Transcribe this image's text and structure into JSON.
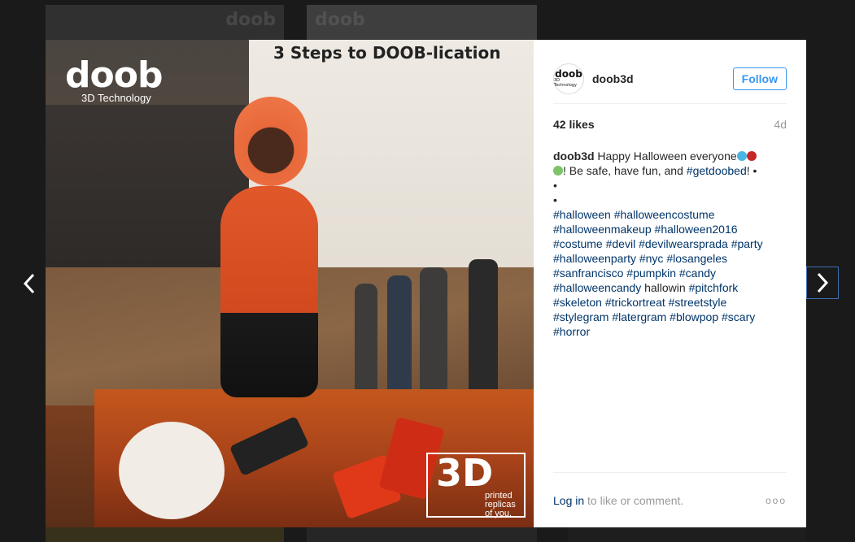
{
  "background": {
    "tiles": [
      "doob",
      "doob",
      "doob"
    ]
  },
  "post": {
    "image": {
      "brand": "doob",
      "brand_sub": "3D Technology",
      "sign": "3 Steps to DOOB-lication",
      "stamp_big": "3D",
      "stamp_small": "printed replicas of you."
    },
    "author": {
      "avatar_text": "doob",
      "avatar_sub": "3D Technology",
      "username": "doob3d",
      "follow_label": "Follow"
    },
    "likes": "42 likes",
    "age": "4d",
    "caption": {
      "user": "doob3d",
      "text_1": " Happy Halloween everyone",
      "text_2": "! Be safe, have fun, and ",
      "tag_getdoobed": "#getdoobed",
      "text_3": "! •",
      "bullet_1": "•",
      "bullet_2": "•",
      "hashtags": [
        "#halloween",
        "#halloweencostume",
        "#halloweenmakeup",
        "#halloween2016",
        "#costume",
        "#devil",
        "#devilwearsprada",
        "#party",
        "#halloweenparty",
        "#nyc",
        "#losangeles",
        "#sanfrancisco",
        "#pumpkin",
        "#candy",
        "#halloweencandy"
      ],
      "plain_word": "hallowin",
      "hashtags_2": [
        "#pitchfork",
        "#skeleton",
        "#trickortreat",
        "#streetstyle",
        "#stylegram",
        "#latergram",
        "#blowpop",
        "#scary",
        "#horror"
      ]
    },
    "footer": {
      "login_label": "Log in",
      "login_suffix": " to like or comment.",
      "more_label": "ooo"
    }
  },
  "colors": {
    "link": "#003569",
    "follow": "#3897f0",
    "overlay": "#3a3a3a"
  },
  "icons": [
    "chevron-left-icon",
    "chevron-right-icon",
    "more-options-icon"
  ]
}
